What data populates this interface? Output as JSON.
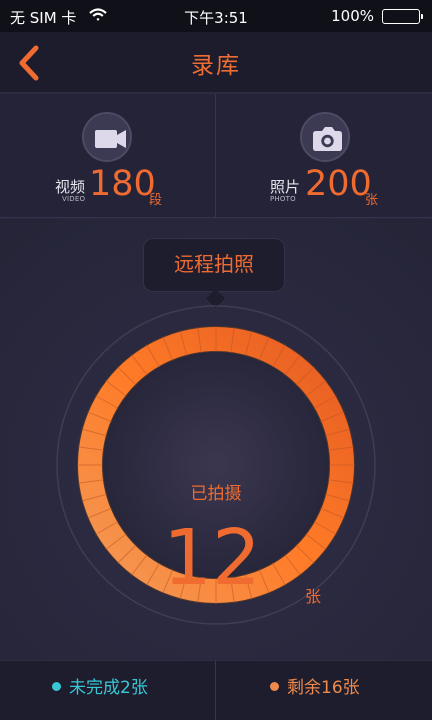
{
  "status_bar": {
    "carrier": "无 SIM 卡",
    "time": "下午3:51",
    "battery_percent": "100%",
    "battery_level": 1.0,
    "icons": [
      "wifi-icon",
      "battery-icon"
    ]
  },
  "header": {
    "title": "录库",
    "back_icon": "chevron-left-icon"
  },
  "stats": {
    "video": {
      "icon": "video-camera-icon",
      "label": "视频",
      "sublabel": "VIDEO",
      "count": "180",
      "unit": "段"
    },
    "photo": {
      "icon": "camera-icon",
      "label": "照片",
      "sublabel": "PHOTO",
      "count": "200",
      "unit": "张"
    }
  },
  "remote": {
    "button_label": "远程拍照",
    "ring": {
      "label": "已拍摄",
      "count": "12",
      "unit": "张",
      "progress": 1.0
    }
  },
  "legend": {
    "pending": {
      "text": "未完成2张",
      "color": "#38c7d5"
    },
    "remaining": {
      "text": "剩余16张",
      "color": "#ef8a4d"
    }
  },
  "colors": {
    "accent": "#ef6b30",
    "header_bg": "#1d1c2d",
    "main_bg": "#2a293f"
  }
}
